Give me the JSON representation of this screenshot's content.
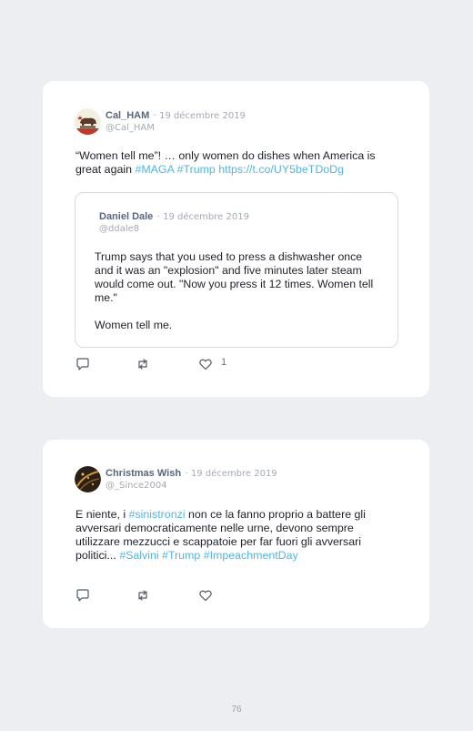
{
  "tweets": [
    {
      "author": "Cal_HAM",
      "date": "· 19 décembre 2019",
      "handle": "@Cal_HAM",
      "text_plain": "“Women tell me”! … only women do dishes when America is great again ",
      "text_tags": "#MAGA #Trump https://t.co/UY5beTDoDg",
      "likes": "1",
      "quoted": {
        "author": "Daniel Dale",
        "date": "· 19 décembre 2019",
        "handle": "@ddale8",
        "text": "Trump says that you used to press a dishwasher once and it was an \"explosion\" and five minutes later steam would come out. \"Now you press it 12 times. Women tell me.\"",
        "text2": "Women tell me."
      }
    },
    {
      "author": "Christmas Wish",
      "date": "· 19 décembre 2019",
      "handle": "@_Since2004",
      "text_1": "E niente, i ",
      "tag_1": "#sinistronzi",
      "text_2": " non ce la fanno proprio a battere gli avversari democraticamente nelle urne, devono sempre utilizzare mezzucci e scappatoie per far fuori gli avversari politici... ",
      "tags_end": "#Salvini #Trump #ImpeachmentDay"
    }
  ],
  "icons": [
    "reply-icon",
    "retweet-icon",
    "like-icon"
  ],
  "colors": {
    "background": "#eceef1",
    "card": "#ffffff",
    "link": "#52b6e2",
    "name": "#56677d"
  },
  "page_number": "76"
}
